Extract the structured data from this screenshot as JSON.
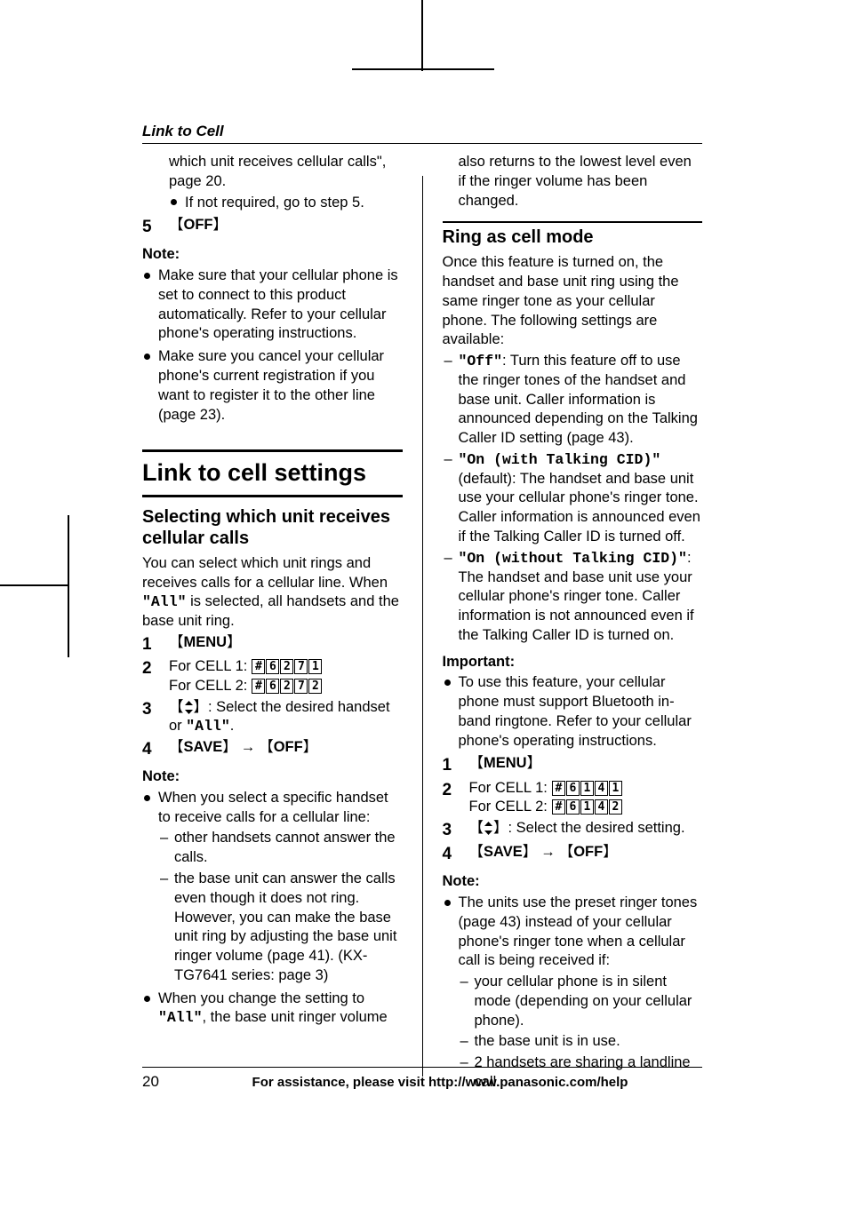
{
  "runningHead": "Link to Cell",
  "leftCol": {
    "hanging1": "which unit receives cellular calls\", page 20.",
    "hangingBullet": "If not required, go to step 5.",
    "step5Num": "5",
    "step5Label": "OFF",
    "noteHead": "Note:",
    "notes": [
      "Make sure that your cellular phone is set to connect to this product automatically. Refer to your cellular phone's operating instructions.",
      "Make sure you cancel your cellular phone's current registration if you want to register it to the other line (page 23)."
    ],
    "topicTitle": "Link to cell settings",
    "subTitle": "Selecting which unit receives cellular calls",
    "introA": "You can select which unit rings and receives calls for a cellular line. When ",
    "introAll": "\"All\"",
    "introB": " is selected, all handsets and the base unit ring.",
    "s1Num": "1",
    "s1Label": "MENU",
    "s2Num": "2",
    "s2CellA": "For CELL 1: ",
    "s2CellB": "For CELL 2: ",
    "code1": [
      "#",
      "6",
      "2",
      "7",
      "1"
    ],
    "code2": [
      "#",
      "6",
      "2",
      "7",
      "2"
    ],
    "s3Num": "3",
    "s3Text": ": Select the desired handset or ",
    "s3All": "\"All\"",
    "s4Num": "4",
    "s4Save": "SAVE",
    "s4Off": "OFF",
    "note2Head": "Note:",
    "note2a": "When you select a specific handset to receive calls for a cellular line:",
    "note2aSub": [
      "other handsets cannot answer the calls.",
      "the base unit can answer the calls even though it does not ring. However, you can make the base unit ring by adjusting the base unit ringer volume (page 41). (KX-TG7641 series: page 3)"
    ],
    "note2bA": "When you change the setting to ",
    "note2bAll": "\"All\"",
    "note2bB": ", the base unit ringer volume"
  },
  "rightCol": {
    "carry": "also returns to the lowest level even if the ringer volume has been changed.",
    "sectionTitle": "Ring as cell mode",
    "intro": "Once this feature is turned on, the handset and base unit ring using the same ringer tone as your cellular phone. The following settings are available:",
    "opts": [
      {
        "labelA": "\"",
        "code": "Off",
        "labelB": "\"",
        "text": ": Turn this feature off to use the ringer tones of the handset and base unit. Caller information is announced depending on the Talking Caller ID setting (page 43)."
      },
      {
        "labelA": "\"",
        "code": "On (with Talking CID)",
        "labelB": "\"",
        "text": " (default): The handset and base unit use your cellular phone's ringer tone. Caller information is announced even if the Talking Caller ID is turned off."
      },
      {
        "labelA": "\"",
        "code": "On (without Talking CID)",
        "labelB": "\"",
        "text": ": The handset and base unit use your cellular phone's ringer tone. Caller information is not announced even if the Talking Caller ID is turned on."
      }
    ],
    "importantHead": "Important:",
    "importantText": "To use this feature, your cellular phone must support Bluetooth in-band ringtone. Refer to your cellular phone's operating instructions.",
    "r1Num": "1",
    "r1Label": "MENU",
    "r2Num": "2",
    "r2CellA": "For CELL 1: ",
    "r2CellB": "For CELL 2: ",
    "rcode1": [
      "#",
      "6",
      "1",
      "4",
      "1"
    ],
    "rcode2": [
      "#",
      "6",
      "1",
      "4",
      "2"
    ],
    "r3Num": "3",
    "r3Text": ": Select the desired setting.",
    "r4Num": "4",
    "r4Save": "SAVE",
    "r4Off": "OFF",
    "rNoteHead": "Note:",
    "rNoteIntro": "The units use the preset ringer tones (page 43) instead of your cellular phone's ringer tone when a cellular call is being received if:",
    "rNoteSub": [
      "your cellular phone is in silent mode (depending on your cellular phone).",
      "the base unit is in use.",
      "2 handsets are sharing a landline call."
    ]
  },
  "footer": {
    "pageNum": "20",
    "text": "For assistance, please visit http://www.panasonic.com/help"
  }
}
